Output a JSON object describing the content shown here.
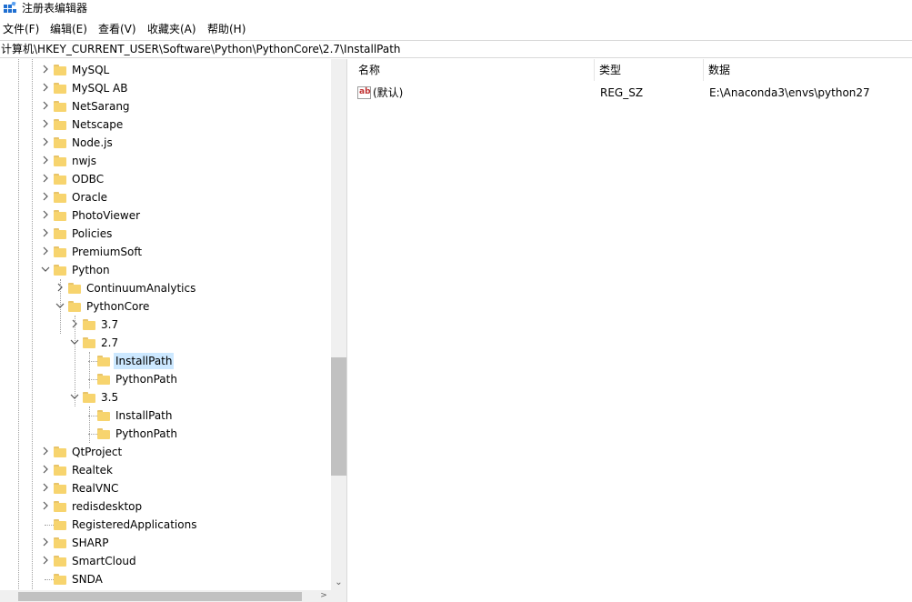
{
  "window": {
    "title": "注册表编辑器"
  },
  "menu": [
    {
      "label": "文件(F)"
    },
    {
      "label": "编辑(E)"
    },
    {
      "label": "查看(V)"
    },
    {
      "label": "收藏夹(A)"
    },
    {
      "label": "帮助(H)"
    }
  ],
  "address": {
    "path": "计算机\\HKEY_CURRENT_USER\\Software\\Python\\PythonCore\\2.7\\InstallPath"
  },
  "tree": {
    "items": [
      {
        "label": "MySQL",
        "level": 0,
        "expander": "collapsed"
      },
      {
        "label": "MySQL AB",
        "level": 0,
        "expander": "collapsed"
      },
      {
        "label": "NetSarang",
        "level": 0,
        "expander": "collapsed"
      },
      {
        "label": "Netscape",
        "level": 0,
        "expander": "collapsed"
      },
      {
        "label": "Node.js",
        "level": 0,
        "expander": "collapsed"
      },
      {
        "label": "nwjs",
        "level": 0,
        "expander": "collapsed"
      },
      {
        "label": "ODBC",
        "level": 0,
        "expander": "collapsed"
      },
      {
        "label": "Oracle",
        "level": 0,
        "expander": "collapsed"
      },
      {
        "label": "PhotoViewer",
        "level": 0,
        "expander": "collapsed"
      },
      {
        "label": "Policies",
        "level": 0,
        "expander": "collapsed"
      },
      {
        "label": "PremiumSoft",
        "level": 0,
        "expander": "collapsed"
      },
      {
        "label": "Python",
        "level": 0,
        "expander": "expanded"
      },
      {
        "label": "ContinuumAnalytics",
        "level": 1,
        "expander": "collapsed"
      },
      {
        "label": "PythonCore",
        "level": 1,
        "expander": "expanded"
      },
      {
        "label": "3.7",
        "level": 2,
        "expander": "collapsed"
      },
      {
        "label": "2.7",
        "level": 2,
        "expander": "expanded"
      },
      {
        "label": "InstallPath",
        "level": 3,
        "expander": "none",
        "selected": true
      },
      {
        "label": "PythonPath",
        "level": 3,
        "expander": "none"
      },
      {
        "label": "3.5",
        "level": 2,
        "expander": "expanded"
      },
      {
        "label": "InstallPath",
        "level": 3,
        "expander": "none"
      },
      {
        "label": "PythonPath",
        "level": 3,
        "expander": "none"
      },
      {
        "label": "QtProject",
        "level": 0,
        "expander": "collapsed"
      },
      {
        "label": "Realtek",
        "level": 0,
        "expander": "collapsed"
      },
      {
        "label": "RealVNC",
        "level": 0,
        "expander": "collapsed"
      },
      {
        "label": "redisdesktop",
        "level": 0,
        "expander": "collapsed"
      },
      {
        "label": "RegisteredApplications",
        "level": 0,
        "expander": "none"
      },
      {
        "label": "SHARP",
        "level": 0,
        "expander": "collapsed"
      },
      {
        "label": "SmartCloud",
        "level": 0,
        "expander": "collapsed"
      },
      {
        "label": "SNDA",
        "level": 0,
        "expander": "none"
      }
    ]
  },
  "list": {
    "columns": [
      {
        "label": "名称"
      },
      {
        "label": "类型"
      },
      {
        "label": "数据"
      }
    ],
    "rows": [
      {
        "icon": "string-value-icon",
        "icon_text": "ab",
        "name": "(默认)",
        "type": "REG_SZ",
        "data": "E:\\Anaconda3\\envs\\python27"
      }
    ]
  },
  "colors": {
    "selection": "#cce8ff",
    "folder": "#f7d46e",
    "scrollbar_thumb": "#c1c1c1"
  }
}
